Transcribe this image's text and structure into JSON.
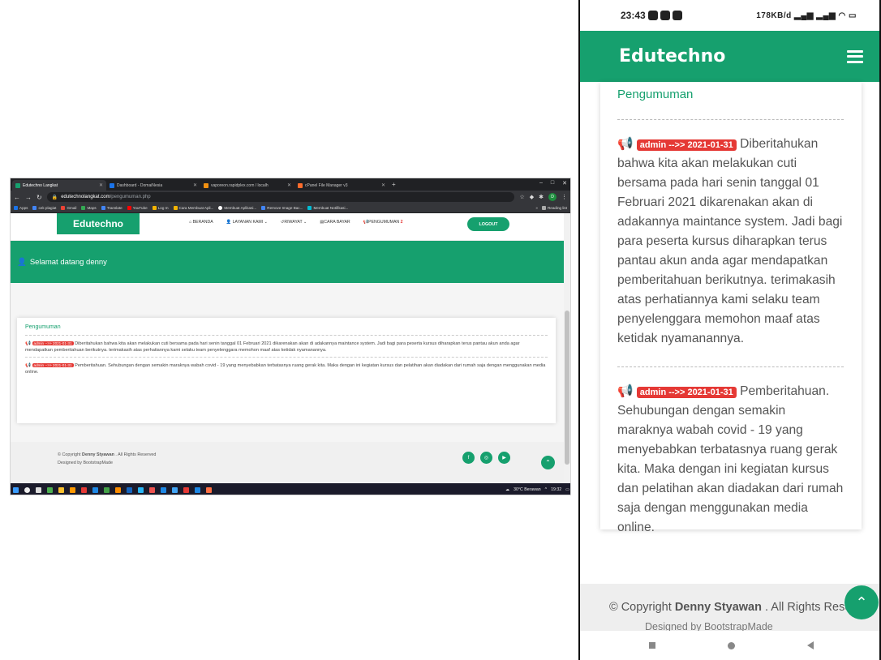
{
  "desktop": {
    "tabs": [
      {
        "label": "Edutechno Langkat",
        "color": "#16a06e",
        "active": true
      },
      {
        "label": "Dashboard - DomaiNesia",
        "color": "#1a73e8",
        "active": false
      },
      {
        "label": "vaporeon.rapidplex.com / localh",
        "color": "#f29111",
        "active": false
      },
      {
        "label": "cPanel File Manager v3",
        "color": "#ff6c2c",
        "active": false
      }
    ],
    "url_host": "edutechnolangkat.com",
    "url_path": "/pengumuman.php",
    "bookmarks": [
      "Apps",
      "cek plagiat",
      "Gmail",
      "Maps",
      "Translate",
      "YouTube",
      "Log In",
      "Cara Membuat Apli...",
      "Membuat Aplikasi...",
      "Remove Image Bac...",
      "Membuat Notifikasi..."
    ],
    "reading_list": "Reading list",
    "site": {
      "brand": "Edutechno",
      "menu": [
        "BERANDA",
        "LAYANAN KAMI",
        "RIWAYAT",
        "CARA BAYAR",
        "PENGUMUMAN"
      ],
      "menu_badge": "2",
      "logout": "LOGOUT",
      "welcome": "Selamat datang denny",
      "card_title": "Pengumuman",
      "announcements": [
        {
          "tag": "admin -->> 2021-01-31",
          "text": "Diberitahukan bahwa kita akan melakukan cuti bersama pada hari senin tanggal 01 Februari 2021 dikarenakan akan di adakannya maintance system. Jadi bagi para peserta kursus diharapkan terus pantau akun anda agar mendapatkan pemberitahuan berikutnya. terimakasih atas perhatiannya kami selaku team penyelenggara memohon maaf atas ketidak nyamanannya."
        },
        {
          "tag": "admin -->> 2021-01-31",
          "text": "Pemberitahuan. Sehubungan dengan semakin maraknya wabah covid - 19 yang menyebabkan terbatasnya ruang gerak kita. Maka dengan ini kegiatan kursus dan pelatihan akan diadakan dari rumah saja dengan menggunakan media online."
        }
      ],
      "footer_prefix": "© Copyright",
      "footer_name": "Denny Styawan",
      "footer_suffix": ". All Rights Reserved",
      "designed_by": "Designed by BootstrapMade"
    },
    "taskbar": {
      "weather": "30°C Berawan",
      "time": "19:32"
    }
  },
  "phone": {
    "time": "23:43",
    "status_right": "178KB/d",
    "brand": "Edutechno",
    "card_title": "Pengumuman",
    "announcements": [
      {
        "tag": "admin -->> 2021-01-31",
        "text": "Diberitahukan bahwa kita akan melakukan cuti bersama pada hari senin tanggal 01 Februari 2021 dikarenakan akan di adakannya maintance system. Jadi bagi para peserta kursus diharapkan terus pantau akun anda agar mendapatkan pemberitahuan berikutnya. terimakasih atas perhatiannya kami selaku team penyelenggara memohon maaf atas ketidak nyamanannya."
      },
      {
        "tag": "admin -->> 2021-01-31",
        "text": "Pemberitahuan. Sehubungan dengan semakin maraknya wabah covid - 19 yang menyebabkan terbatasnya ruang gerak kita. Maka dengan ini kegiatan kursus dan pelatihan akan diadakan dari rumah saja dengan menggunakan media online."
      }
    ],
    "footer_prefix": "© Copyright",
    "footer_name": "Denny Styawan",
    "footer_suffix": ". All Rights Reserv",
    "designed_by": "Designed by BootstrapMade"
  },
  "colors": {
    "brand_green": "#16a06e",
    "tag_red": "#e53935"
  }
}
